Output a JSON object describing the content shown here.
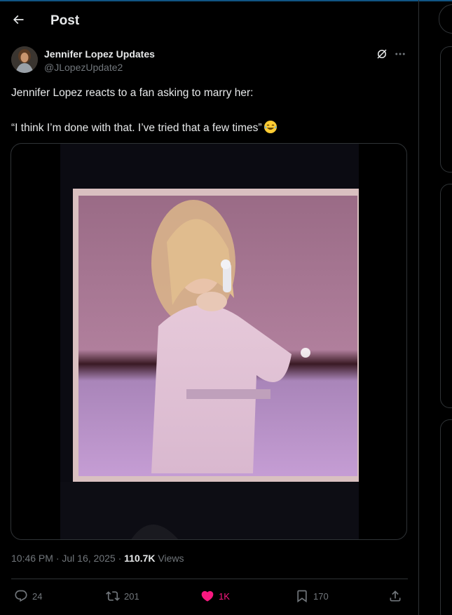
{
  "header": {
    "title": "Post"
  },
  "author": {
    "name": "Jennifer Lopez Updates",
    "handle": "@JLopezUpdate2"
  },
  "tweet": {
    "line1": "Jennifer Lopez reacts to a fan asking to marry her:",
    "line2": "“I think I’m done with that. I’ve tried that a few times”",
    "emoji_icon": "face-with-tears-of-joy-emoji"
  },
  "meta": {
    "time": "10:46 PM",
    "date": "Jul 16, 2025",
    "separator": "·",
    "views_count": "110.7K",
    "views_label": "Views"
  },
  "actions": {
    "replies": "24",
    "reposts": "201",
    "likes": "1K",
    "bookmarks": "170"
  },
  "colors": {
    "background": "#000000",
    "text": "#e7e9ea",
    "muted": "#71767b",
    "border": "#2f3336",
    "like": "#f91880",
    "accent": "#1d9bf0"
  },
  "icons": {
    "back": "arrow-left-icon",
    "grok": "grok-icon",
    "more": "more-icon",
    "reply": "reply-icon",
    "repost": "repost-icon",
    "like": "heart-icon",
    "bookmark": "bookmark-icon",
    "share": "share-icon"
  }
}
